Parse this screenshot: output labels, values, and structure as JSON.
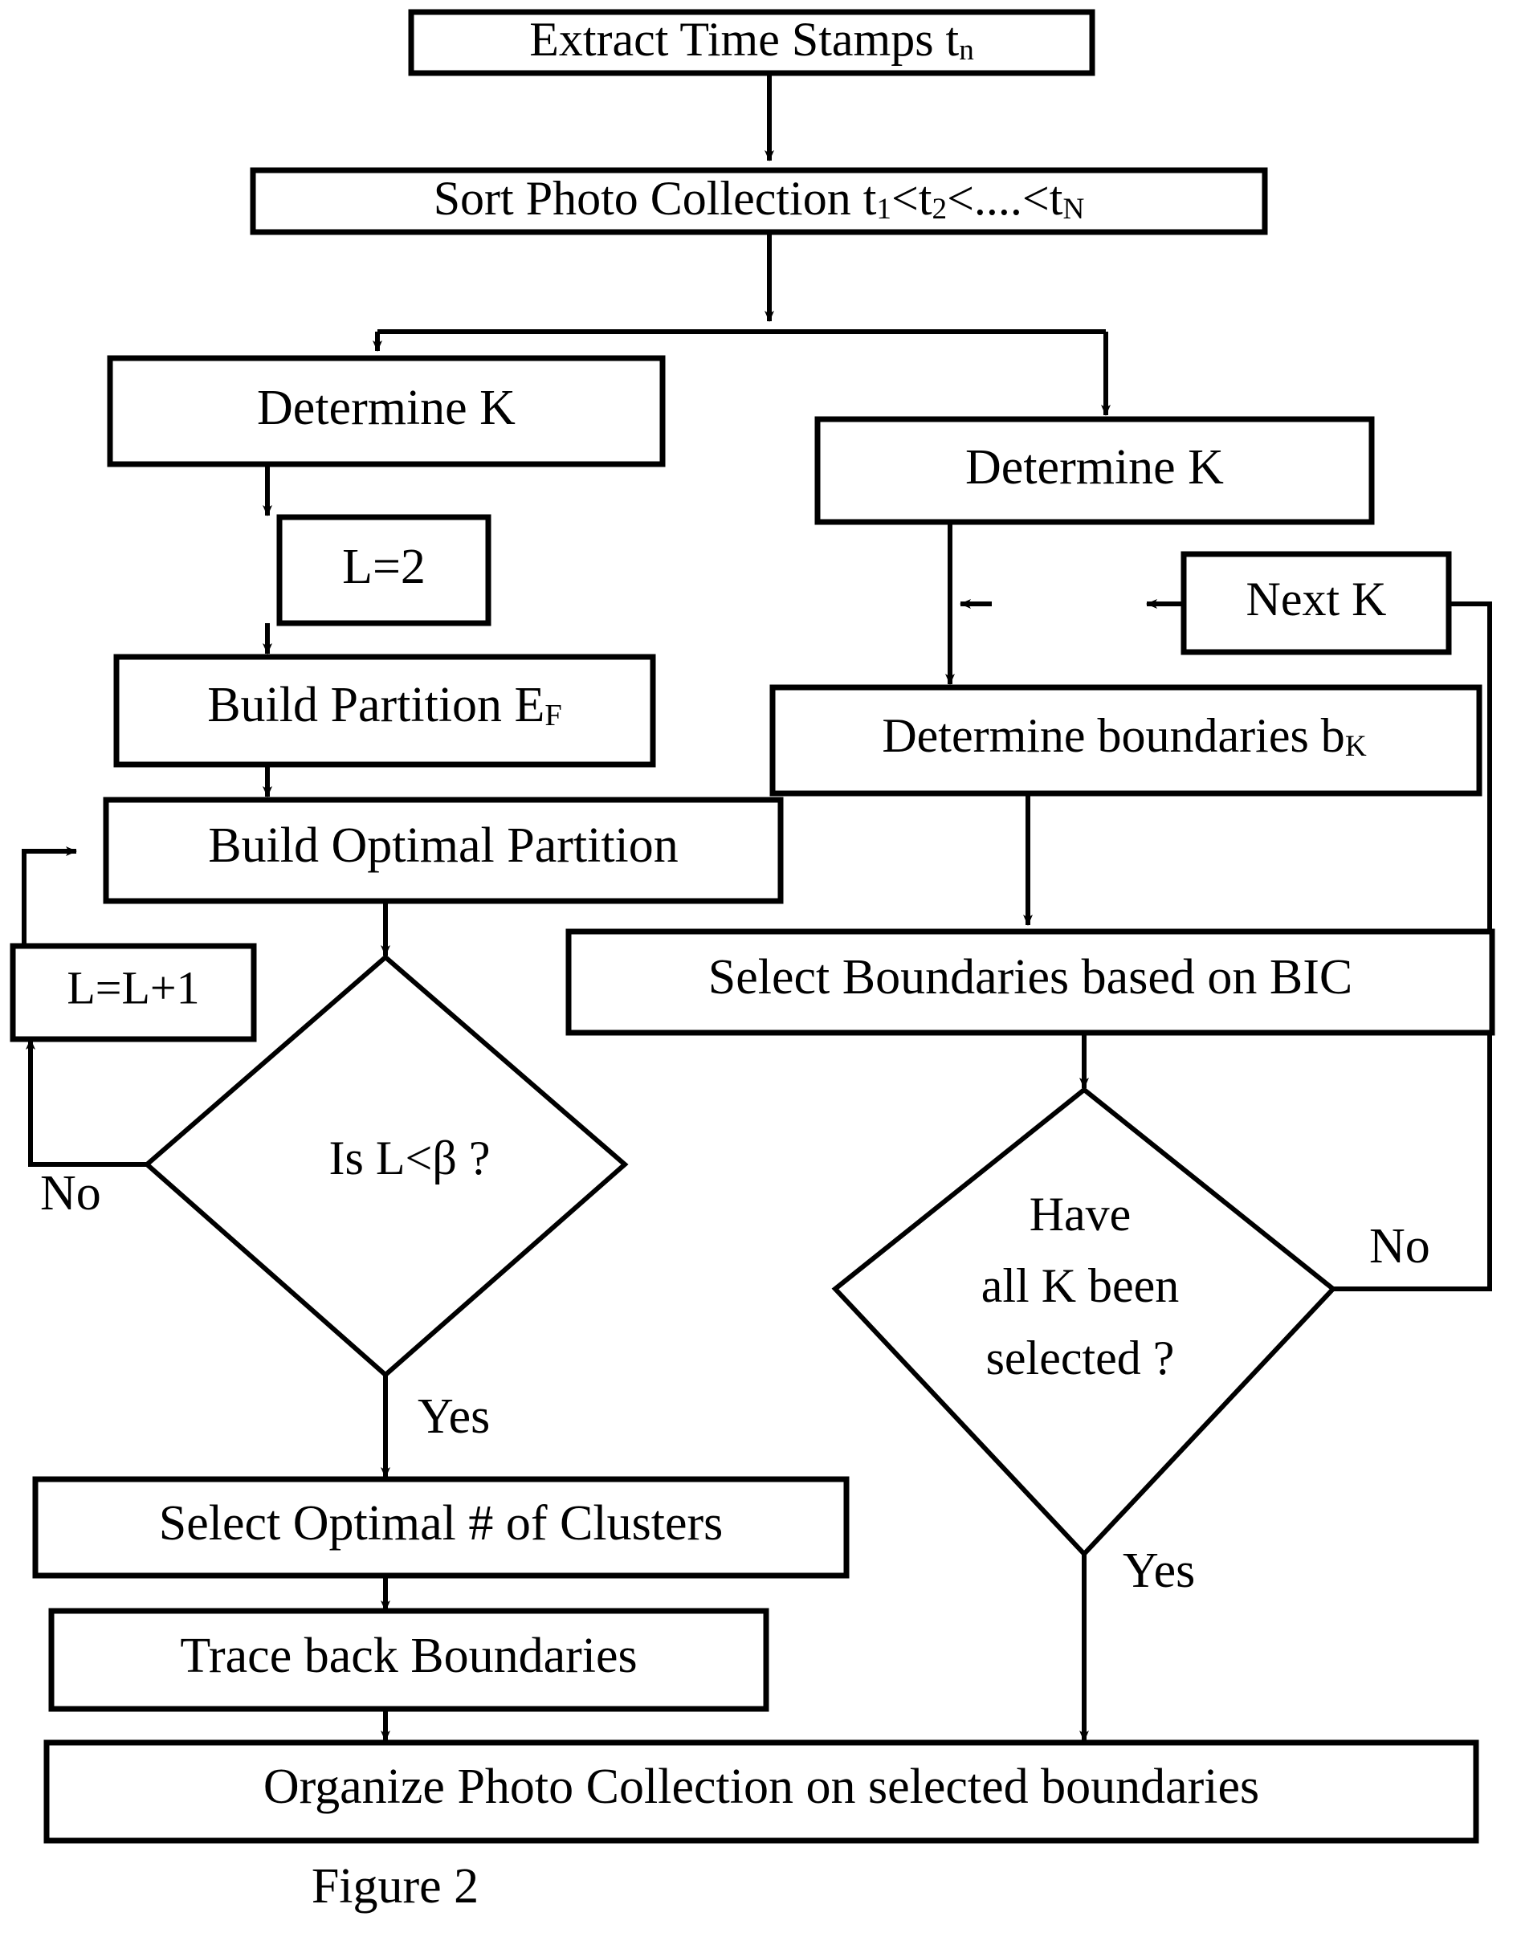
{
  "figure": {
    "caption": "Figure 2",
    "caption_font_size": 62
  },
  "chart_data": {
    "type": "diagram",
    "title": "Figure 2",
    "subtype": "flowchart",
    "nodes": [
      {
        "id": "extract",
        "shape": "process",
        "label": "Extract Time Stamps t",
        "sub": "n",
        "label_tail": ""
      },
      {
        "id": "sort",
        "shape": "process",
        "label": "Sort Photo Collection t",
        "sub": "1",
        "label_tail": "<t₂<....<t_N"
      },
      {
        "id": "determineK_l",
        "shape": "process",
        "label": "Determine K"
      },
      {
        "id": "l2",
        "shape": "process",
        "label": "L=2"
      },
      {
        "id": "buildpart",
        "shape": "process",
        "label": "Build Partition E",
        "sub": "F"
      },
      {
        "id": "buildopt",
        "shape": "process",
        "label": "Build Optimal Partition"
      },
      {
        "id": "lplus",
        "shape": "process",
        "label": "L=L+1"
      },
      {
        "id": "isl",
        "shape": "decision",
        "label": "Is L<β ?"
      },
      {
        "id": "selclusters",
        "shape": "process",
        "label": "Select Optimal # of Clusters"
      },
      {
        "id": "traceback",
        "shape": "process",
        "label": "Trace back Boundaries"
      },
      {
        "id": "determineK_r",
        "shape": "process",
        "label": "Determine K"
      },
      {
        "id": "nextk",
        "shape": "process",
        "label": "Next K"
      },
      {
        "id": "detbounds",
        "shape": "process",
        "label": "Determine boundaries b",
        "sub": "K"
      },
      {
        "id": "selbic",
        "shape": "process",
        "label": "Select Boundaries based on BIC"
      },
      {
        "id": "haveall",
        "shape": "decision",
        "label": "Have / all K been / selected ?"
      },
      {
        "id": "organize",
        "shape": "process",
        "label": "Organize Photo Collection on selected boundaries"
      }
    ],
    "edge_labels": [
      "No",
      "Yes",
      "No",
      "Yes"
    ]
  },
  "nodes": {
    "extract": {
      "label_main": "Extract Time Stamps t",
      "label_sub": "n",
      "label_after": ""
    },
    "sort": {
      "seg1": "Sort Photo Collection t",
      "sub1": "1",
      "seg2": "<t",
      "sub2": "2",
      "seg3": "<....<t",
      "sub3": "N"
    },
    "determine_k_left": {
      "label": "Determine K"
    },
    "l_equals_2": {
      "label": "L=2"
    },
    "build_partition": {
      "seg1": "Build Partition E",
      "sub1": "F"
    },
    "build_optimal_partition": {
      "label": "Build Optimal Partition"
    },
    "l_increment": {
      "label": "L=L+1"
    },
    "is_l_less_beta": {
      "label": "Is L<β ?"
    },
    "select_optimal_clusters": {
      "label": "Select Optimal # of Clusters"
    },
    "trace_back_boundaries": {
      "label": "Trace back Boundaries"
    },
    "determine_k_right": {
      "label": "Determine K"
    },
    "next_k": {
      "label": "Next K"
    },
    "determine_boundaries": {
      "seg1": "Determine boundaries b",
      "sub1": "K"
    },
    "select_boundaries_bic": {
      "label": "Select Boundaries based on BIC"
    },
    "have_all_k": {
      "line1": "Have",
      "line2": "all K been",
      "line3": "selected ?"
    },
    "organize_photo_collection": {
      "label": "Organize Photo Collection on selected boundaries"
    }
  },
  "edges": {
    "left_no": "No",
    "left_yes": "Yes",
    "right_no": "No",
    "right_yes": "Yes"
  },
  "colors": {
    "stroke": "#000000",
    "fill": "#ffffff",
    "text": "#000000"
  }
}
